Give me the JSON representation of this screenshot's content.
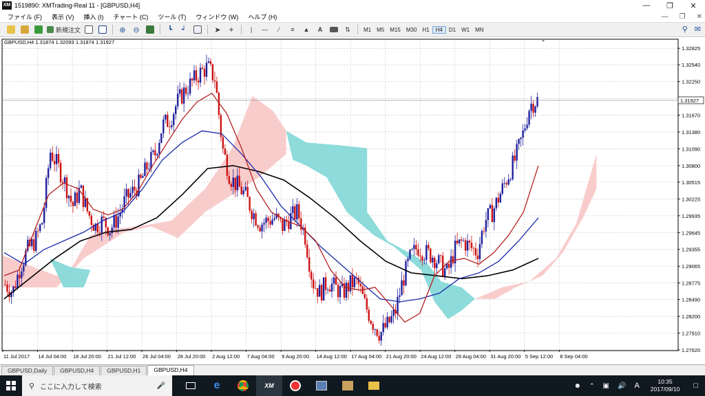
{
  "window": {
    "title": "1519890: XMTrading-Real 11 - [GBPUSD,H4]",
    "logo": "XM"
  },
  "menu": [
    "ファイル (F)",
    "表示 (V)",
    "挿入 (I)",
    "チャート (C)",
    "ツール (T)",
    "ウィンドウ (W)",
    "ヘルプ (H)"
  ],
  "toolbar": {
    "new_order_label": "新規注文",
    "timeframes": [
      "M1",
      "M5",
      "M15",
      "M30",
      "H1",
      "H4",
      "D1",
      "W1",
      "MN"
    ],
    "active_timeframe": "H4"
  },
  "chart_data": {
    "type": "candlestick",
    "title": "GBPUSD,H4  1.31874 1.32093 1.31874 1.31927",
    "symbol": "GBPUSD",
    "timeframe": "H4",
    "ohlc": {
      "open": 1.31874,
      "high": 1.32093,
      "low": 1.31874,
      "close": 1.31927
    },
    "current_price": "1.31927",
    "ylim": [
      1.2762,
      1.3297
    ],
    "y_ticks": [
      "1.32825",
      "1.32540",
      "1.32250",
      "1.31960",
      "1.31670",
      "1.31380",
      "1.31090",
      "1.30800",
      "1.30515",
      "1.30225",
      "1.29935",
      "1.29645",
      "1.29355",
      "1.29065",
      "1.28775",
      "1.28490",
      "1.28200",
      "1.27910",
      "1.27620"
    ],
    "x_ticks": [
      "11 Jul 2017",
      "14 Jul 04:00",
      "18 Jul 20:00",
      "21 Jul 12:00",
      "26 Jul 04:00",
      "28 Jul 20:00",
      "2 Aug 12:00",
      "7 Aug 04:00",
      "9 Aug 20:00",
      "14 Aug 12:00",
      "17 Aug 04:00",
      "21 Aug 20:00",
      "24 Aug 12:00",
      "29 Aug 04:00",
      "31 Aug 20:00",
      "5 Sep 12:00",
      "8 Sep 04:00"
    ],
    "close_path": [
      1.2875,
      1.2862,
      1.2905,
      1.2935,
      1.295,
      1.2985,
      1.3105,
      1.308,
      1.305,
      1.301,
      1.304,
      1.3,
      1.2975,
      1.2985,
      1.297,
      1.299,
      1.302,
      1.3035,
      1.305,
      1.308,
      1.31,
      1.315,
      1.316,
      1.319,
      1.321,
      1.3225,
      1.324,
      1.325,
      1.323,
      1.311,
      1.306,
      1.3045,
      1.303,
      1.3,
      1.298,
      1.2985,
      1.299,
      1.2975,
      1.299,
      1.3,
      1.296,
      1.288,
      1.286,
      1.288,
      1.287,
      1.286,
      1.2875,
      1.288,
      1.284,
      1.281,
      1.279,
      1.2805,
      1.2825,
      1.288,
      1.292,
      1.294,
      1.293,
      1.2925,
      1.291,
      1.2895,
      1.2935,
      1.295,
      1.294,
      1.293,
      1.2985,
      1.3,
      1.303,
      1.306,
      1.309,
      1.313,
      1.3185,
      1.3193
    ],
    "sma_red": [
      1.289,
      1.29,
      1.2965,
      1.303,
      1.305,
      1.304,
      1.3005,
      1.2995,
      1.3005,
      1.3035,
      1.308,
      1.312,
      1.316,
      1.319,
      1.3205,
      1.317,
      1.311,
      1.304,
      1.3,
      1.2985,
      1.2975,
      1.295,
      1.29,
      1.287,
      1.2865,
      1.287,
      1.284,
      1.281,
      1.2825,
      1.289,
      1.2915,
      1.292,
      1.291,
      1.293,
      1.296,
      1.3,
      1.308
    ],
    "sma_blue": [
      1.293,
      1.291,
      1.2935,
      1.295,
      1.2965,
      1.2985,
      1.3,
      1.304,
      1.309,
      1.312,
      1.314,
      1.3135,
      1.31,
      1.306,
      1.301,
      1.2975,
      1.294,
      1.291,
      1.288,
      1.285,
      1.2845,
      1.285,
      1.286,
      1.2885,
      1.2895,
      1.2915,
      1.295,
      1.299
    ],
    "sma_black": [
      1.285,
      1.2885,
      1.292,
      1.295,
      1.2965,
      1.297,
      1.299,
      1.303,
      1.3075,
      1.308,
      1.307,
      1.3055,
      1.3025,
      1.299,
      1.295,
      1.2915,
      1.2895,
      1.289,
      1.2885,
      1.289,
      1.29,
      1.292
    ],
    "cloud_colors": {
      "bearish": "#f9c9c9",
      "bullish": "#87d9d9"
    },
    "colors": {
      "up_candle": "#1e1e9c",
      "down_candle": "#cc1111",
      "grid": "#c8c8c8",
      "ma_red": "#b52020",
      "ma_blue": "#1a2aa8",
      "ma_black": "#000000"
    }
  },
  "tabs": [
    "GBPUSD,Daily",
    "GBPUSD,H4",
    "GBPUSD,H1",
    "GBPUSD,H4"
  ],
  "active_tab": 3,
  "taskbar": {
    "search_placeholder": "ここに入力して検索",
    "time": "10:35",
    "date": "2017/09/10",
    "ime": "A"
  }
}
